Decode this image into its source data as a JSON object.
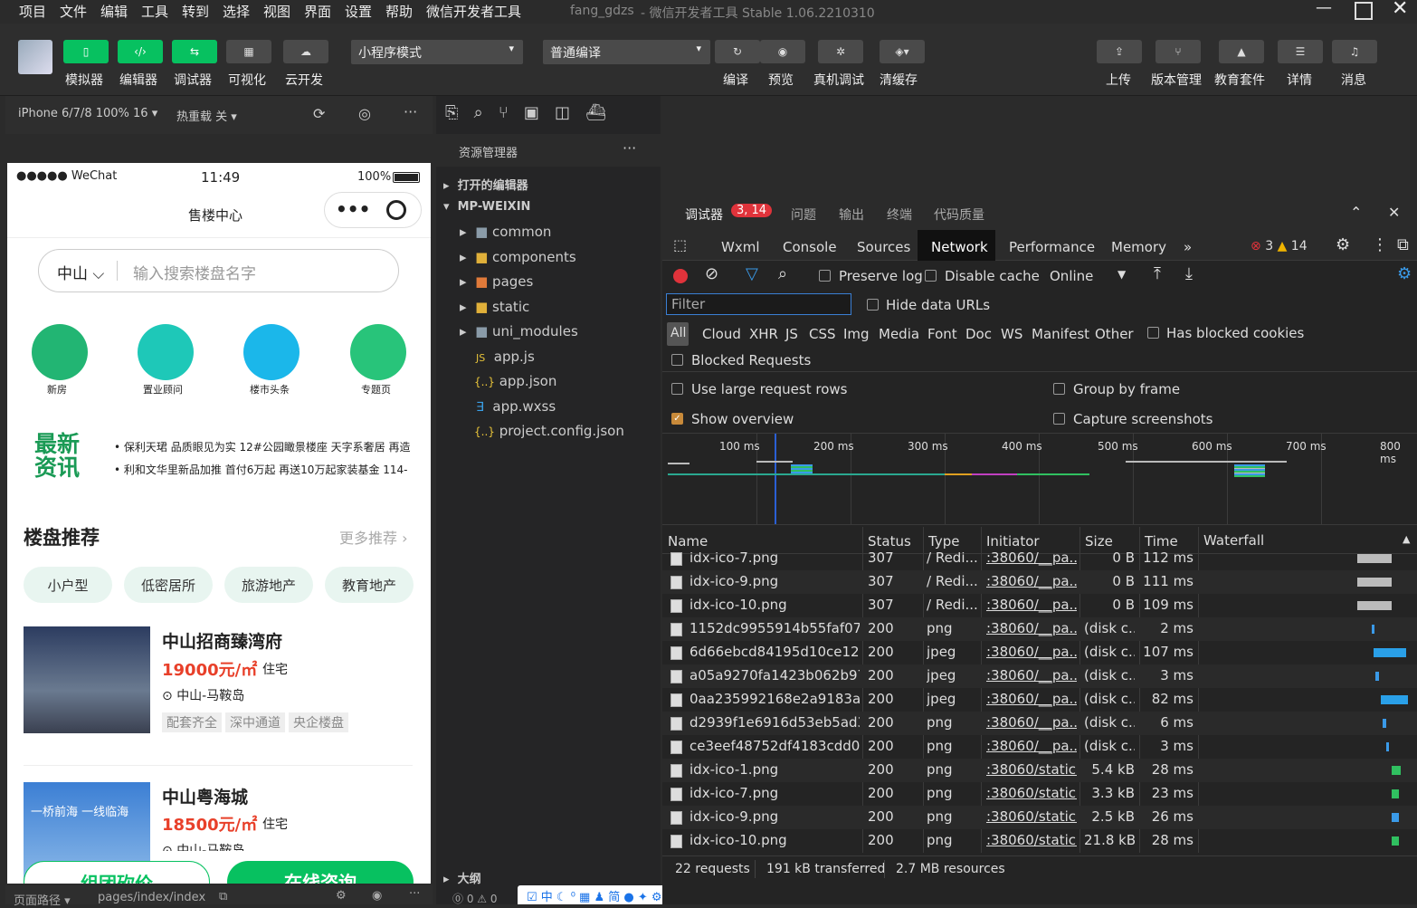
{
  "menubar": {
    "items": [
      "项目",
      "文件",
      "编辑",
      "工具",
      "转到",
      "选择",
      "视图",
      "界面",
      "设置",
      "帮助",
      "微信开发者工具"
    ],
    "project": "fang_gdzs",
    "app_title": "- 微信开发者工具 Stable 1.06.2210310"
  },
  "toolbar": {
    "simulator": "模拟器",
    "editor": "编辑器",
    "debugger": "调试器",
    "visual": "可视化",
    "cloud": "云开发",
    "mode": "小程序模式",
    "compile_mode": "普通编译",
    "compile": "编译",
    "preview": "预览",
    "real_debug": "真机调试",
    "clear_cache": "清缓存",
    "upload": "上传",
    "version": "版本管理",
    "edu": "教育套件",
    "details": "详情",
    "messages": "消息"
  },
  "simbar": {
    "device": "iPhone 6/7/8 100% 16",
    "hot_reload": "热重载 关"
  },
  "phone": {
    "carrier": "●●●●● WeChat",
    "time": "11:49",
    "battery": "100%",
    "nav_title": "售楼中心",
    "city": "中山",
    "search_placeholder": "输入搜索楼盘名字",
    "icons": [
      {
        "label": "新房",
        "color": "#22b573"
      },
      {
        "label": "置业顾问",
        "color": "#1ec8b8"
      },
      {
        "label": "楼市头条",
        "color": "#1bb7ea"
      },
      {
        "label": "专题页",
        "color": "#28c47a"
      }
    ],
    "news_logo": "最新资讯",
    "news": [
      "保利天珺 品质眼见为实 12#公园瞰景楼座 天字系奢居 再造",
      "利和文华里新品加推 首付6万起 再送10万起家装基金 114-"
    ],
    "rec_title": "楼盘推荐",
    "more": "更多推荐",
    "chips": [
      "小户型",
      "低密居所",
      "旅游地产",
      "教育地产"
    ],
    "listings": [
      {
        "name": "中山招商臻湾府",
        "price": "19000元/㎡",
        "kind": "住宅",
        "loc": "中山-马鞍岛",
        "tags": [
          "配套齐全",
          "深中通道",
          "央企楼盘"
        ]
      },
      {
        "name": "中山粤海城",
        "price": "18500元/㎡",
        "kind": "住宅",
        "loc": "中山-马鞍岛",
        "img_text": "一桥前海 一线临海"
      }
    ],
    "btn_left": "组团砍价",
    "btn_right": "在线咨询"
  },
  "statusbar": {
    "path_label": "页面路径",
    "path": "pages/index/index",
    "errors": "⓪ 0 ⚠ 0"
  },
  "explorer": {
    "title": "资源管理器",
    "open_editors": "打开的编辑器",
    "root": "MP-WEIXIN",
    "outline": "大纲",
    "items": [
      {
        "name": "common",
        "kind": "folder"
      },
      {
        "name": "components",
        "kind": "folder"
      },
      {
        "name": "pages",
        "kind": "folder"
      },
      {
        "name": "static",
        "kind": "folder"
      },
      {
        "name": "uni_modules",
        "kind": "folder"
      },
      {
        "name": "app.js",
        "kind": "js"
      },
      {
        "name": "app.json",
        "kind": "json"
      },
      {
        "name": "app.wxss",
        "kind": "css"
      },
      {
        "name": "project.config.json",
        "kind": "json"
      }
    ]
  },
  "devtools": {
    "tabs": [
      "调试器",
      "问题",
      "输出",
      "终端",
      "代码质量"
    ],
    "badge": "3, 14",
    "panels": [
      "Wxml",
      "Console",
      "Sources",
      "Network",
      "Performance",
      "Memory"
    ],
    "errors": "3",
    "warnings": "14",
    "preserve_log": "Preserve log",
    "disable_cache": "Disable cache",
    "throttle": "Online",
    "filter_placeholder": "Filter",
    "hide_data_urls": "Hide data URLs",
    "types": [
      "All",
      "Cloud",
      "XHR",
      "JS",
      "CSS",
      "Img",
      "Media",
      "Font",
      "Doc",
      "WS",
      "Manifest",
      "Other"
    ],
    "blocked_cookies": "Has blocked cookies",
    "blocked_requests": "Blocked Requests",
    "large_rows": "Use large request rows",
    "group_frame": "Group by frame",
    "show_overview": "Show overview",
    "capture": "Capture screenshots",
    "timeline": [
      "100 ms",
      "200 ms",
      "300 ms",
      "400 ms",
      "500 ms",
      "600 ms",
      "700 ms",
      "800 ms"
    ],
    "columns": [
      "Name",
      "Status",
      "Type",
      "Initiator",
      "Size",
      "Time",
      "Waterfall"
    ],
    "rows": [
      {
        "name": "idx-ico-7.png",
        "status": "307",
        "type": "/ Redi...",
        "init": ":38060/__pa...",
        "size": "0 B",
        "time": "112 ms"
      },
      {
        "name": "idx-ico-9.png",
        "status": "307",
        "type": "/ Redi...",
        "init": ":38060/__pa...",
        "size": "0 B",
        "time": "111 ms"
      },
      {
        "name": "idx-ico-10.png",
        "status": "307",
        "type": "/ Redi...",
        "init": ":38060/__pa...",
        "size": "0 B",
        "time": "109 ms"
      },
      {
        "name": "1152dc9955914b55faf07b...",
        "status": "200",
        "type": "png",
        "init": ":38060/__pa...",
        "size": "(disk c...",
        "time": "2 ms"
      },
      {
        "name": "6d66ebcd84195d10ce125...",
        "status": "200",
        "type": "jpeg",
        "init": ":38060/__pa...",
        "size": "(disk c...",
        "time": "107 ms"
      },
      {
        "name": "a05a9270fa1423b062b97f...",
        "status": "200",
        "type": "jpeg",
        "init": ":38060/__pa...",
        "size": "(disk c...",
        "time": "3 ms"
      },
      {
        "name": "0aa235992168e2a9183ac9...",
        "status": "200",
        "type": "jpeg",
        "init": ":38060/__pa...",
        "size": "(disk c...",
        "time": "82 ms"
      },
      {
        "name": "d2939f1e6916d53eb5ad3...",
        "status": "200",
        "type": "png",
        "init": ":38060/__pa...",
        "size": "(disk c...",
        "time": "6 ms"
      },
      {
        "name": "ce3eef48752df4183cdd02...",
        "status": "200",
        "type": "png",
        "init": ":38060/__pa...",
        "size": "(disk c...",
        "time": "3 ms"
      },
      {
        "name": "idx-ico-1.png",
        "status": "200",
        "type": "png",
        "init": ":38060/static...",
        "size": "5.4 kB",
        "time": "28 ms"
      },
      {
        "name": "idx-ico-7.png",
        "status": "200",
        "type": "png",
        "init": ":38060/static...",
        "size": "3.3 kB",
        "time": "23 ms"
      },
      {
        "name": "idx-ico-9.png",
        "status": "200",
        "type": "png",
        "init": ":38060/static...",
        "size": "2.5 kB",
        "time": "26 ms"
      },
      {
        "name": "idx-ico-10.png",
        "status": "200",
        "type": "png",
        "init": ":38060/static...",
        "size": "21.8 kB",
        "time": "28 ms"
      }
    ],
    "summary": {
      "requests": "22 requests",
      "transferred": "191 kB transferred",
      "resources": "2.7 MB resources"
    }
  },
  "colors": {
    "accent": "#07c160",
    "price": "#e8402a",
    "record": "#e0333b",
    "link": "#1a73e8"
  }
}
